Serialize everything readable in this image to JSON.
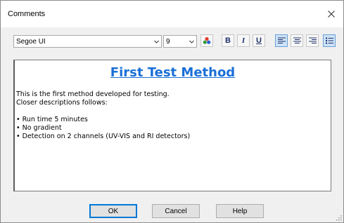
{
  "window": {
    "title": "Comments"
  },
  "toolbar": {
    "font_value": "Segoe UI",
    "size_value": "9",
    "bold_label": "B",
    "italic_label": "I",
    "underline_label": "U"
  },
  "document": {
    "heading": "First Test Method",
    "paragraph_lines": [
      "This is the first method developed for testing.",
      "Closer descriptions follows:"
    ],
    "bullets": [
      "• Run time 5 minutes",
      "• No gradient",
      "• Detection on 2 channels (UV-VIS and RI detectors)"
    ]
  },
  "buttons": {
    "ok": "OK",
    "cancel": "Cancel",
    "help": "Help"
  },
  "colors": {
    "heading": "#1a6fd6",
    "dialog_bg": "#f0f0f0"
  }
}
